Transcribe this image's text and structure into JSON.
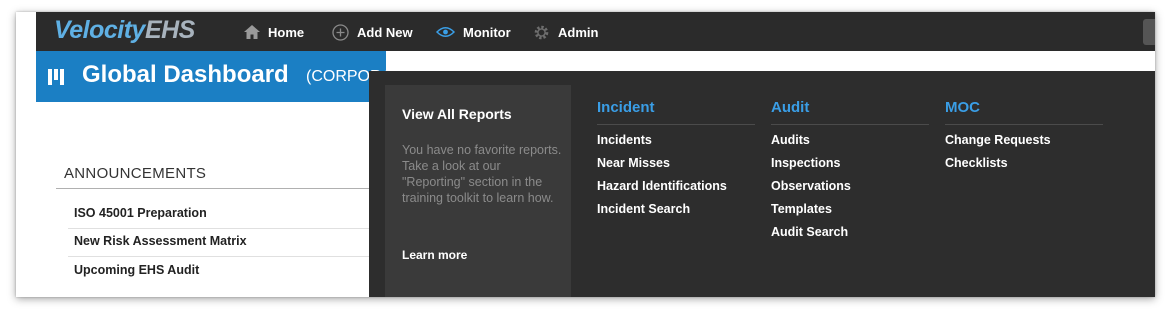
{
  "brand": {
    "part1": "Velocity",
    "part2": "EHS"
  },
  "nav": {
    "items": [
      {
        "label": "Home",
        "icon": "home-icon"
      },
      {
        "label": "Add New",
        "icon": "add-circle-icon"
      },
      {
        "label": "Monitor",
        "icon": "eye-icon"
      },
      {
        "label": "Admin",
        "icon": "gear-icon"
      }
    ]
  },
  "dashboard": {
    "title": "Global Dashboard",
    "subtitle": "(CORPORATI"
  },
  "announcements": {
    "heading": "ANNOUNCEMENTS",
    "items": [
      "ISO 45001 Preparation",
      "New Risk Assessment Matrix",
      "Upcoming EHS Audit"
    ]
  },
  "monitor_menu": {
    "reports": {
      "title": "View All Reports",
      "body": "You have no favorite reports. Take a look at our \"Reporting\" section in the training toolkit to learn how.",
      "link": "Learn more"
    },
    "columns": [
      {
        "heading": "Incident",
        "items": [
          "Incidents",
          "Near Misses",
          "Hazard Identifications",
          "Incident Search"
        ]
      },
      {
        "heading": "Audit",
        "items": [
          "Audits",
          "Inspections",
          "Observations",
          "Templates",
          "Audit Search"
        ]
      },
      {
        "heading": "MOC",
        "items": [
          "Change Requests",
          "Checklists"
        ]
      }
    ]
  },
  "colors": {
    "accent_blue": "#1b7fc4",
    "heading_blue": "#3a9ee6",
    "nav_bg": "#2b2b2b",
    "menu_bg": "#2d2d2d"
  }
}
